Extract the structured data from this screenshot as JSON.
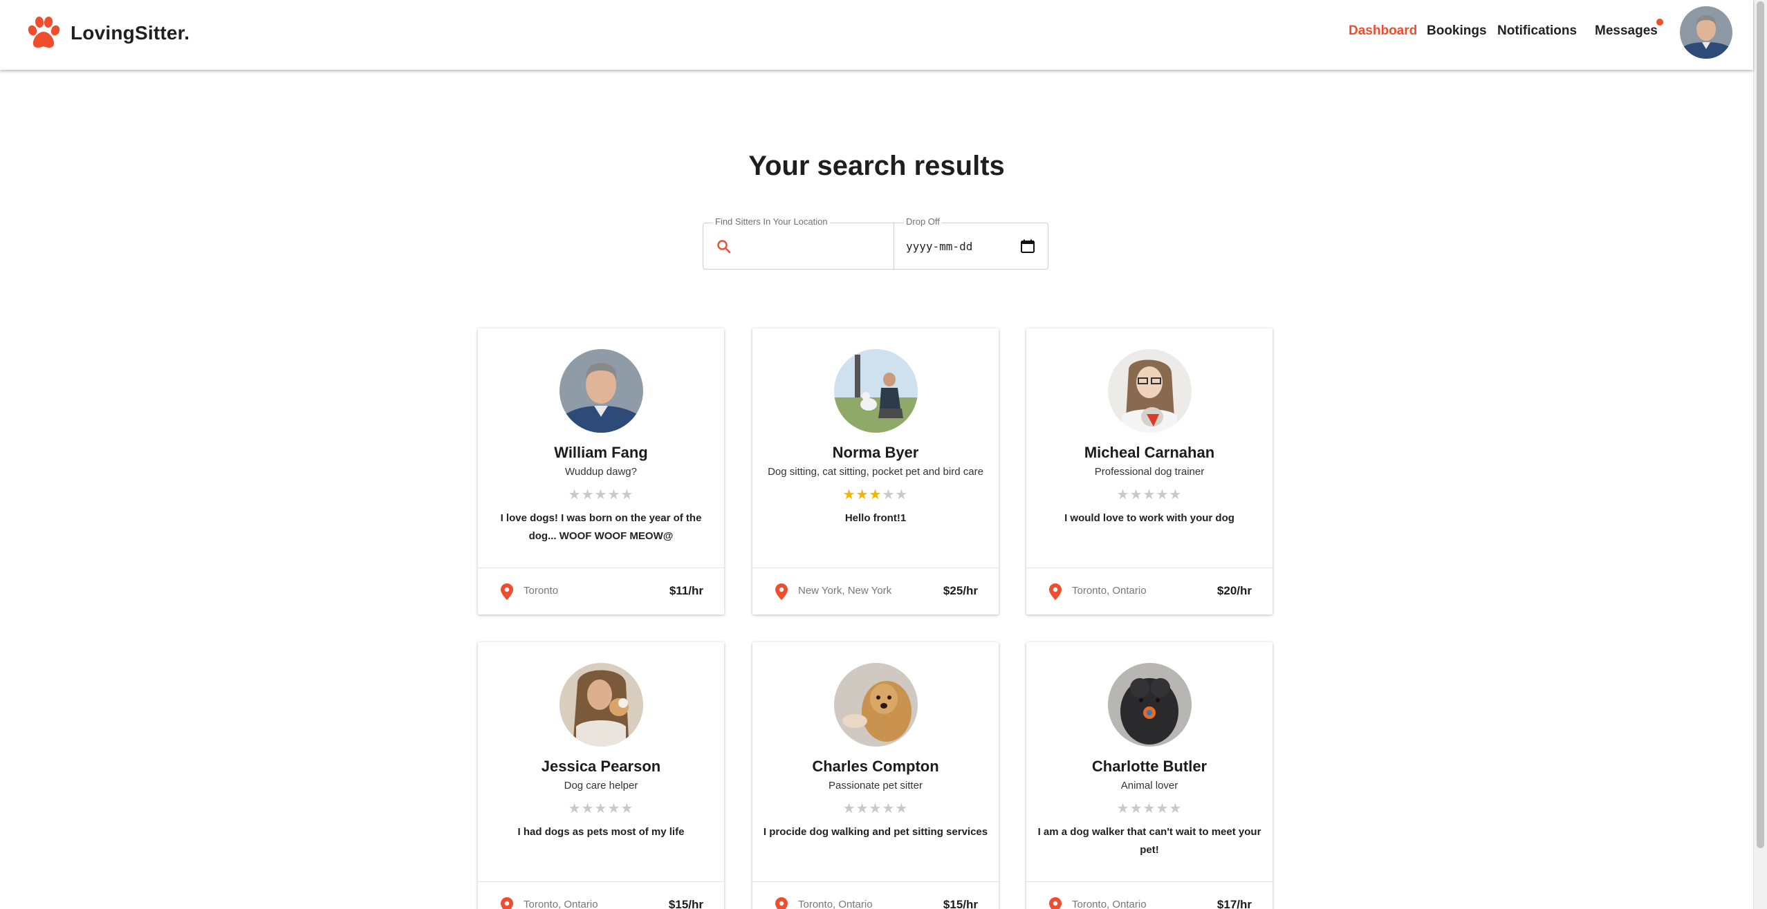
{
  "app": {
    "brand": "LovingSitter.",
    "accent_color": "#f04c2e"
  },
  "nav": {
    "items": [
      {
        "label": "Dashboard",
        "active": true
      },
      {
        "label": "Bookings",
        "active": false
      },
      {
        "label": "Notifications",
        "active": false
      },
      {
        "label": "Messages",
        "active": false,
        "has_unread_dot": true
      }
    ]
  },
  "page": {
    "title": "Your search results"
  },
  "search": {
    "location_label": "Find Sitters In Your Location",
    "location_value": "",
    "dropoff_label": "Drop Off",
    "dropoff_value": "yyyy-mm-dd"
  },
  "sitters": [
    {
      "name": "William Fang",
      "tagline": "Wuddup dawg?",
      "rating": 0,
      "max_rating": 5,
      "description": "I love dogs! I was born on the year of the dog... WOOF WOOF MEOW@",
      "location": "Toronto",
      "price": "$11/hr"
    },
    {
      "name": "Norma Byer",
      "tagline": "Dog sitting, cat sitting, pocket pet and bird care",
      "rating": 3,
      "max_rating": 5,
      "description": "Hello front!1",
      "location": "New York, New York",
      "price": "$25/hr"
    },
    {
      "name": "Micheal Carnahan",
      "tagline": "Professional dog trainer",
      "rating": 0,
      "max_rating": 5,
      "description": "I would love to work with your dog",
      "location": "Toronto, Ontario",
      "price": "$20/hr"
    },
    {
      "name": "Jessica Pearson",
      "tagline": "Dog care helper",
      "rating": 0,
      "max_rating": 5,
      "description": "I had dogs as pets most of my life",
      "location": "Toronto, Ontario",
      "price": "$15/hr"
    },
    {
      "name": "Charles Compton",
      "tagline": "Passionate pet sitter",
      "rating": 0,
      "max_rating": 5,
      "description": "I procide dog walking and pet sitting services",
      "location": "Toronto, Ontario",
      "price": "$15/hr"
    },
    {
      "name": "Charlotte Butler",
      "tagline": "Animal lover",
      "rating": 0,
      "max_rating": 5,
      "description": "I am a dog walker that can't wait to meet your pet!",
      "location": "Toronto, Ontario",
      "price": "$17/hr"
    }
  ]
}
